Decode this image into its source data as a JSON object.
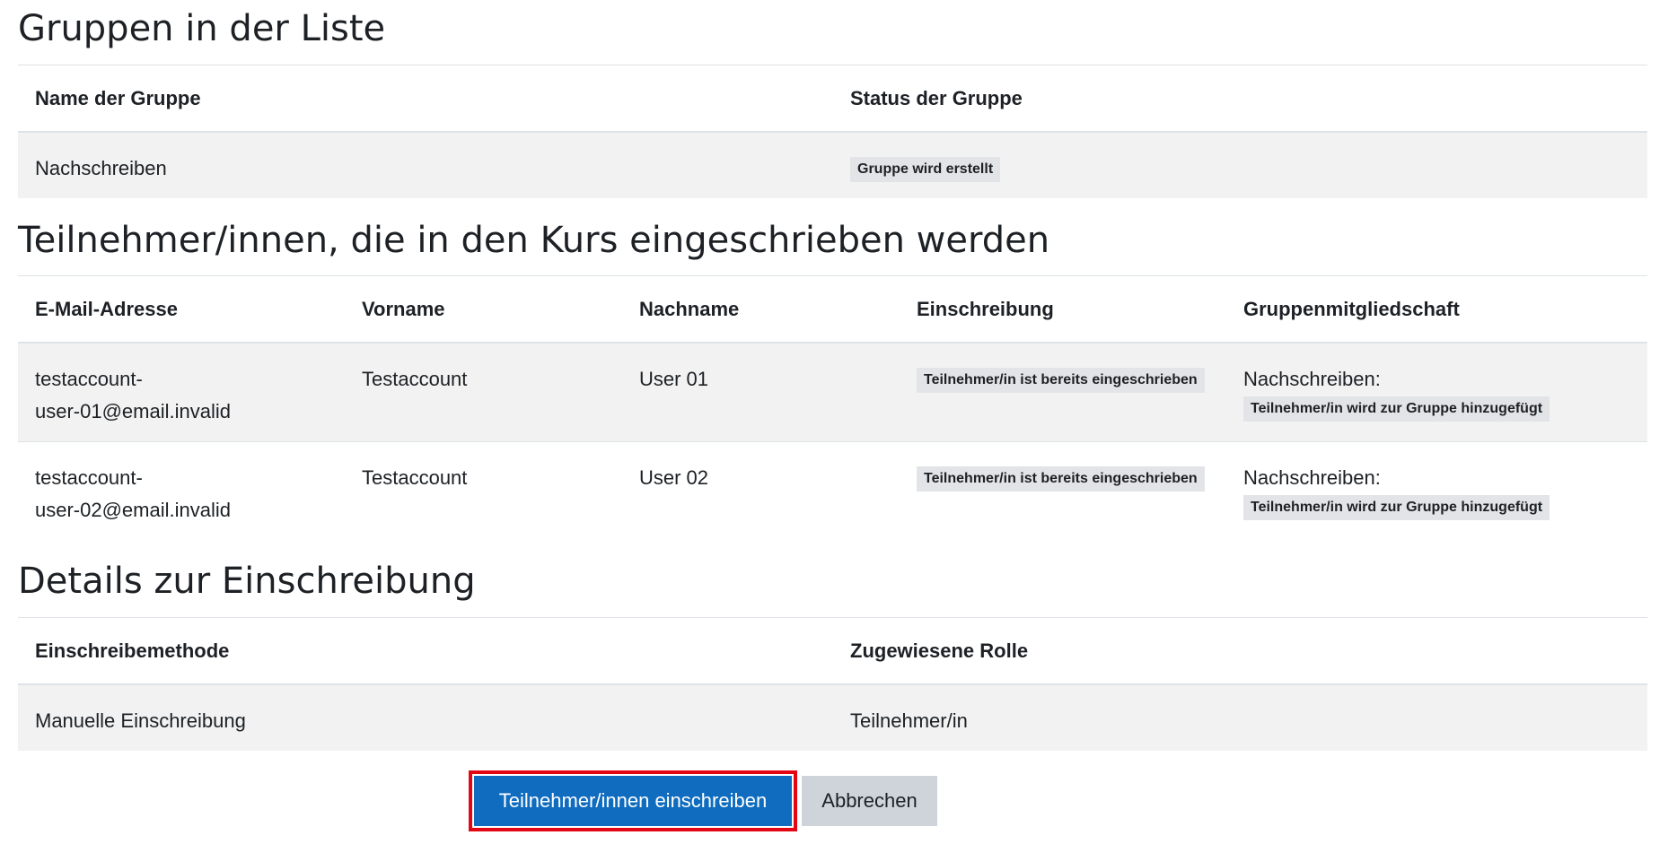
{
  "groups_section": {
    "title": "Gruppen in der Liste",
    "headers": {
      "name": "Name der Gruppe",
      "status": "Status der Gruppe"
    },
    "rows": [
      {
        "name": "Nachschreiben",
        "status": "Gruppe wird erstellt"
      }
    ]
  },
  "participants_section": {
    "title": "Teilnehmer/innen, die in den Kurs eingeschrieben werden",
    "headers": {
      "email": "E-Mail-Adresse",
      "firstname": "Vorname",
      "lastname": "Nachname",
      "enrolment": "Einschreibung",
      "groups": "Gruppenmitgliedschaft"
    },
    "rows": [
      {
        "email_line1": "testaccount-",
        "email_line2": "user-01@email.invalid",
        "firstname": "Testaccount",
        "lastname": "User 01",
        "enrolment": "Teilnehmer/in ist bereits eingeschrieben",
        "group_name": "Nachschreiben:",
        "group_status": "Teilnehmer/in wird zur Gruppe hinzugefügt"
      },
      {
        "email_line1": "testaccount-",
        "email_line2": "user-02@email.invalid",
        "firstname": "Testaccount",
        "lastname": "User 02",
        "enrolment": "Teilnehmer/in ist bereits eingeschrieben",
        "group_name": "Nachschreiben:",
        "group_status": "Teilnehmer/in wird zur Gruppe hinzugefügt"
      }
    ]
  },
  "details_section": {
    "title": "Details zur Einschreibung",
    "headers": {
      "method": "Einschreibemethode",
      "role": "Zugewiesene Rolle"
    },
    "rows": [
      {
        "method": "Manuelle Einschreibung",
        "role": "Teilnehmer/in"
      }
    ]
  },
  "actions": {
    "submit_label": "Teilnehmer/innen einschreiben",
    "cancel_label": "Abbrechen"
  },
  "colors": {
    "primary": "#0f6cbf",
    "secondary": "#ced4da",
    "highlight": "#e30613",
    "badge": "#e2e4e7",
    "stripe": "#f2f2f2"
  }
}
